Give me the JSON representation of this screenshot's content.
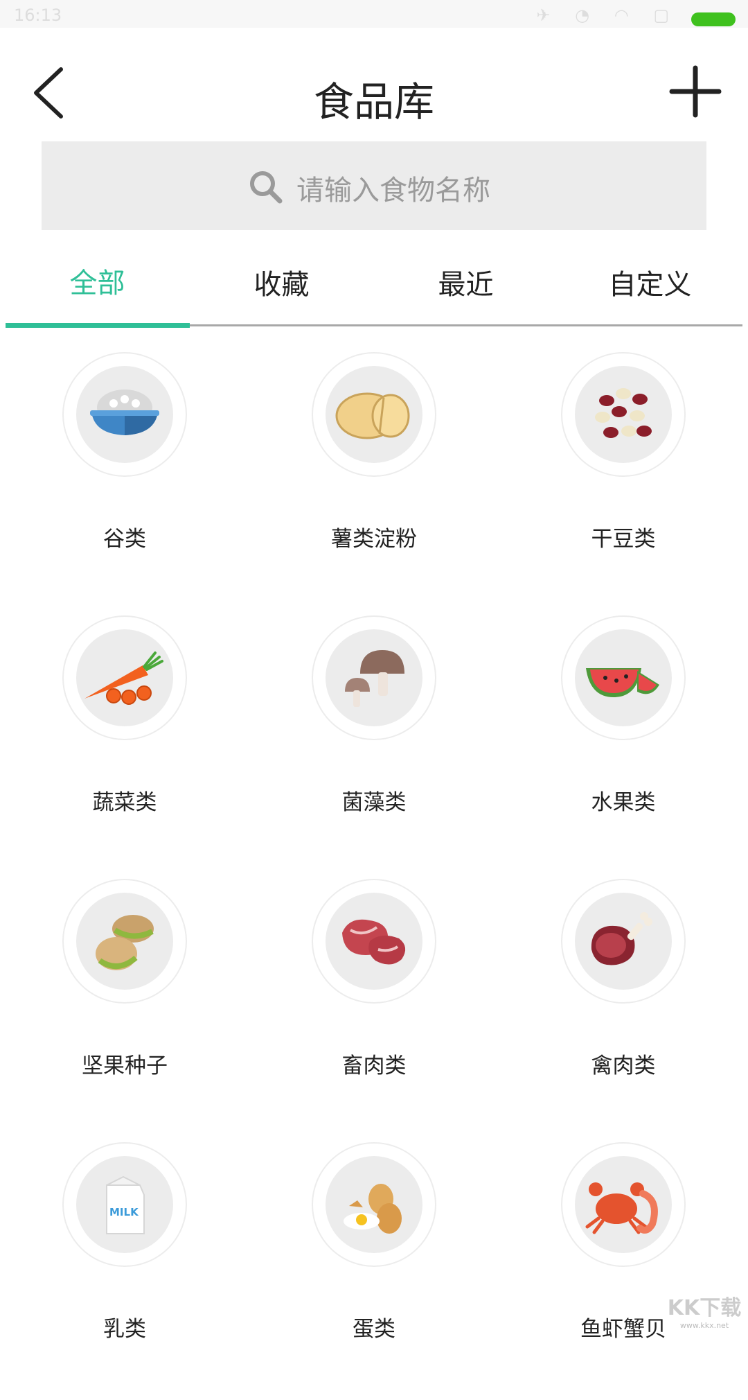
{
  "status_bar": {
    "time": "16:13",
    "icons": "✈ ◔ ◠ ▢"
  },
  "header": {
    "title": "食品库"
  },
  "search": {
    "placeholder": "请输入食物名称"
  },
  "tabs": [
    {
      "label": "全部",
      "active": true
    },
    {
      "label": "收藏",
      "active": false
    },
    {
      "label": "最近",
      "active": false
    },
    {
      "label": "自定义",
      "active": false
    }
  ],
  "categories": [
    {
      "label": "谷类",
      "icon": "rice-bowl-icon"
    },
    {
      "label": "薯类淀粉",
      "icon": "potato-icon"
    },
    {
      "label": "干豆类",
      "icon": "beans-icon"
    },
    {
      "label": "蔬菜类",
      "icon": "carrot-icon"
    },
    {
      "label": "菌藻类",
      "icon": "mushroom-icon"
    },
    {
      "label": "水果类",
      "icon": "watermelon-icon"
    },
    {
      "label": "坚果种子",
      "icon": "pistachio-icon"
    },
    {
      "label": "畜肉类",
      "icon": "meat-icon"
    },
    {
      "label": "禽肉类",
      "icon": "drumstick-icon"
    },
    {
      "label": "乳类",
      "icon": "milk-icon"
    },
    {
      "label": "蛋类",
      "icon": "egg-icon"
    },
    {
      "label": "鱼虾蟹贝",
      "icon": "crab-icon"
    }
  ],
  "watermark": {
    "text": "KK下载",
    "url": "www.kkx.net"
  },
  "colors": {
    "accent": "#2fbf97",
    "battery": "#3fc11e",
    "search_bg": "#ececec"
  }
}
